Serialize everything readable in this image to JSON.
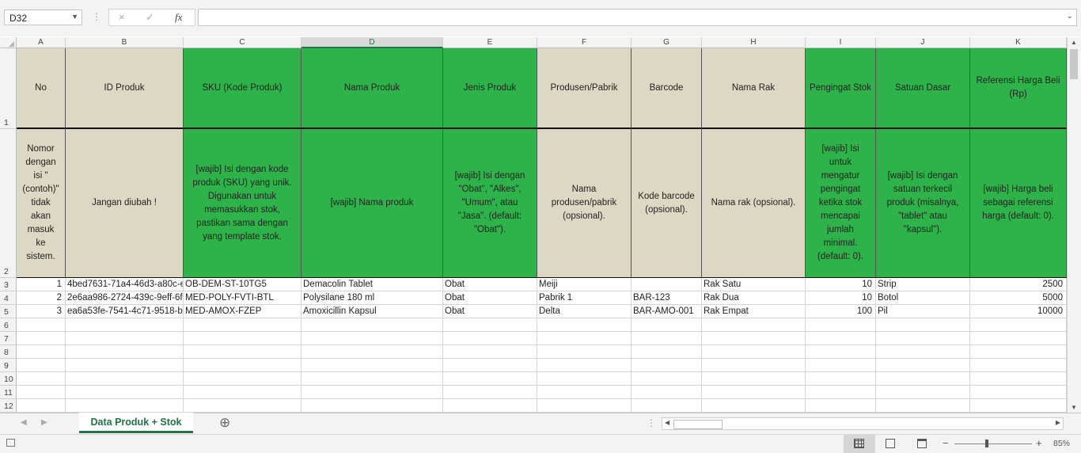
{
  "formula_bar": {
    "name_box": "D32",
    "cancel_icon": "×",
    "enter_icon": "✓",
    "fx_label": "fx",
    "formula": ""
  },
  "columns": [
    "A",
    "B",
    "C",
    "D",
    "E",
    "F",
    "G",
    "H",
    "I",
    "J",
    "K"
  ],
  "selected_column": "D",
  "row_numbers": [
    "1",
    "2",
    "3",
    "4",
    "5",
    "6",
    "7",
    "8",
    "9",
    "10",
    "11",
    "12"
  ],
  "header_row": {
    "A": "No",
    "B": "ID Produk",
    "C": "SKU (Kode Produk)",
    "D": "Nama Produk",
    "E": "Jenis Produk",
    "F": "Produsen/Pabrik",
    "G": "Barcode",
    "H": "Nama Rak",
    "I": "Pengingat Stok",
    "J": "Satuan Dasar",
    "K": "Referensi Harga Beli (Rp)"
  },
  "description_row": {
    "A": "Nomor dengan isi \"(contoh)\" tidak akan masuk ke sistem.",
    "B": "Jangan diubah !",
    "C": "[wajib] Isi dengan kode produk (SKU) yang unik. Digunakan untuk memasukkan stok, pastikan sama dengan yang template stok.",
    "D": "[wajib] Nama produk",
    "E": "[wajib] Isi dengan \"Obat\", \"Alkes\", \"Umum\", atau \"Jasa\". (default: \"Obat\").",
    "F": "Nama produsen/pabrik (opsional).",
    "G": "Kode barcode (opsional).",
    "H": "Nama rak (opsional).",
    "I": "[wajib] Isi untuk mengatur pengingat ketika stok mencapai jumlah minimal. (default: 0).",
    "J": "[wajib] Isi dengan satuan terkecil produk (misalnya, \"tablet\" atau \"kapsul\").",
    "K": "[wajib] Harga beli sebagai referensi harga (default: 0)."
  },
  "header_colors": {
    "beige": "#ddd8c4",
    "green": "#2db34a",
    "A": "beige",
    "B": "beige",
    "C": "green",
    "D": "green",
    "E": "green",
    "F": "beige",
    "G": "beige",
    "H": "beige",
    "I": "green",
    "J": "green",
    "K": "green"
  },
  "rows": [
    [
      "1",
      "4bed7631-71a4-46d3-a80c-e",
      "OB-DEM-ST-10TG5",
      "Demacolin Tablet",
      "Obat",
      "Meiji",
      "",
      "Rak Satu",
      "10",
      "Strip",
      "2500"
    ],
    [
      "2",
      "2e6aa986-2724-439c-9eff-6f",
      "MED-POLY-FVTI-BTL",
      "Polysilane 180 ml",
      "Obat",
      "Pabrik 1",
      "BAR-123",
      "Rak Dua",
      "10",
      "Botol",
      "5000"
    ],
    [
      "3",
      "ea6a53fe-7541-4c71-9518-b.",
      "MED-AMOX-FZEP",
      "Amoxicillin Kapsul",
      "Obat",
      "Delta",
      "BAR-AMO-001",
      "Rak Empat",
      "100",
      "Pil",
      "10000"
    ]
  ],
  "sheet_tabs": [
    {
      "label": "Data Produk + Stok",
      "active": true
    }
  ],
  "add_sheet_icon": "⊕",
  "status": {
    "zoom": "85%",
    "zoom_minus": "−",
    "zoom_plus": "+"
  },
  "accent_color": "#217346"
}
